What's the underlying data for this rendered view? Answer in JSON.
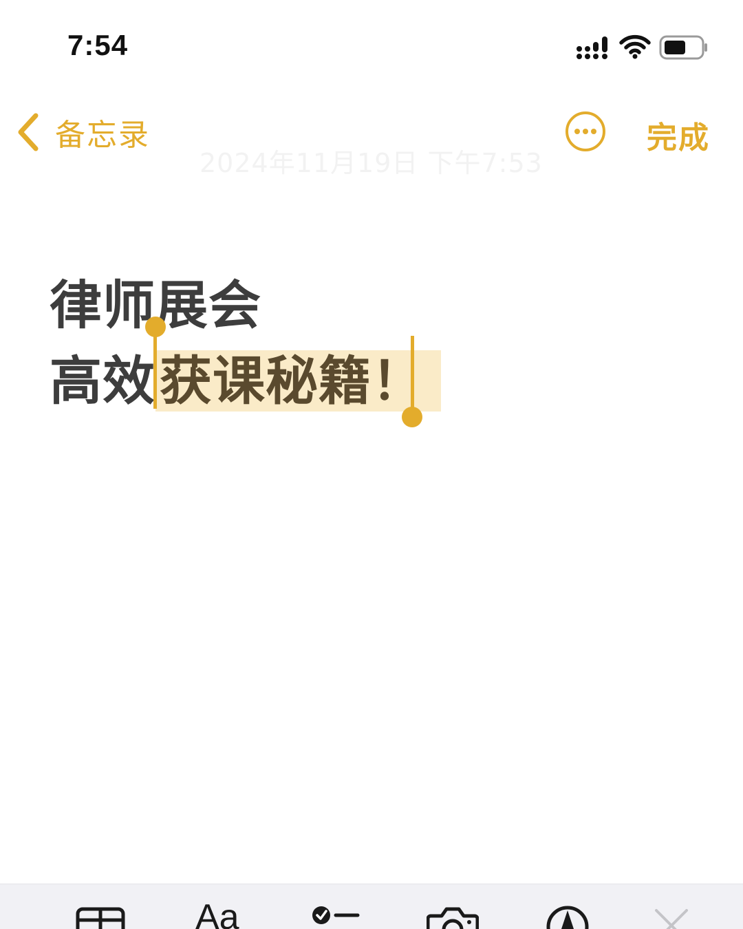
{
  "status_bar": {
    "time": "7:54"
  },
  "nav": {
    "back_label": "备忘录",
    "faded_date": "2024年11月19日 下午7:53",
    "done_label": "完成",
    "accent_color": "#E3AC2C"
  },
  "note": {
    "line1": "律师展会",
    "line2_prefix": "高效",
    "line2_selected": "获课秘籍！",
    "selection_color": "#FAEBC8"
  },
  "toolbar": {
    "format_label": "Aa",
    "items": [
      "table-icon",
      "format-icon",
      "checklist-icon",
      "camera-icon",
      "markup-icon",
      "close-icon"
    ]
  }
}
